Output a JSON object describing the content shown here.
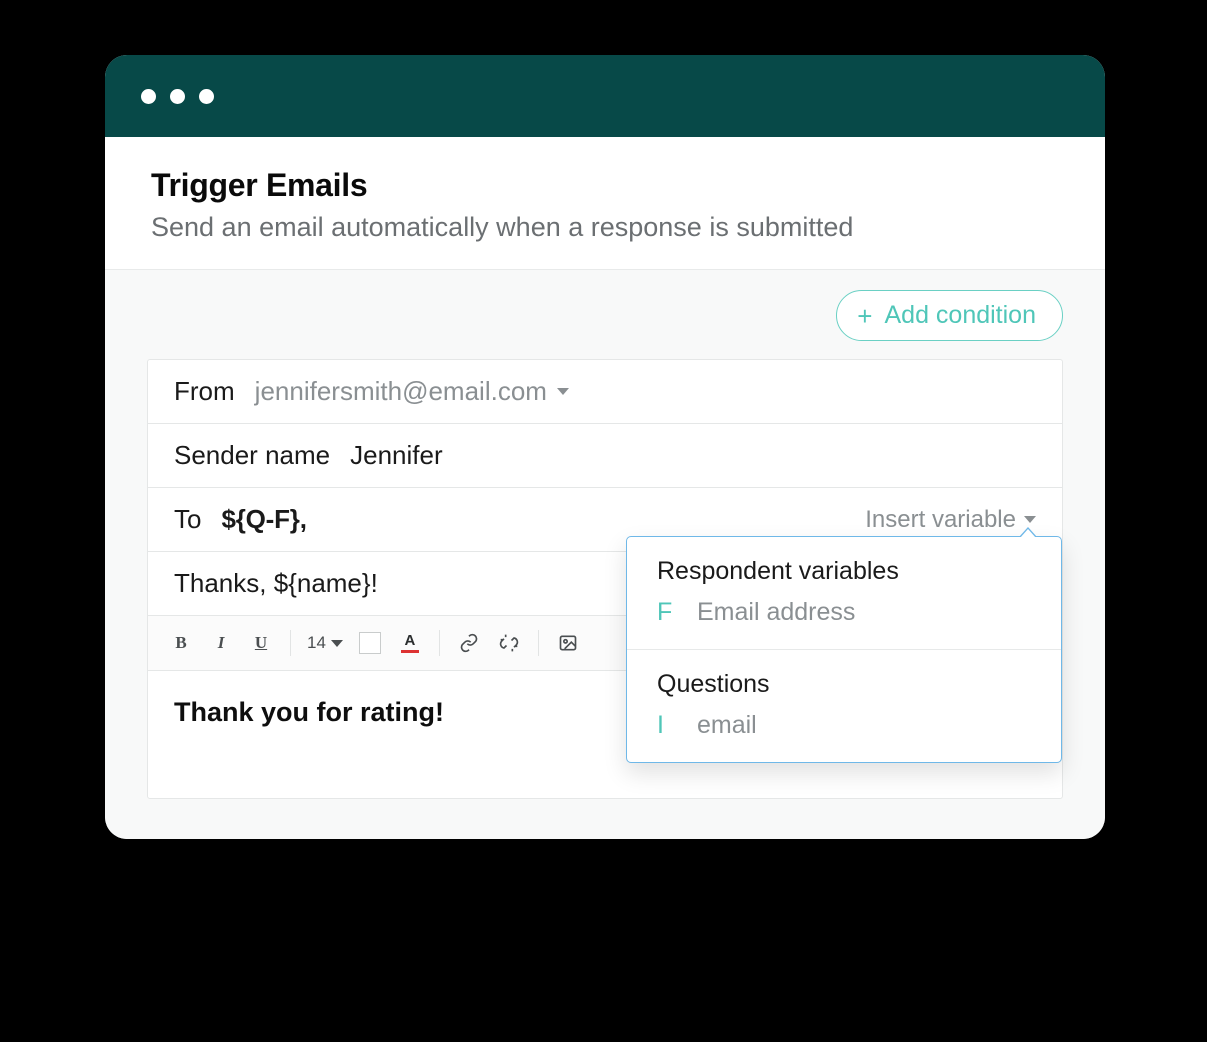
{
  "header": {
    "title": "Trigger Emails",
    "subtitle": "Send an email automatically when a response is submitted"
  },
  "actions": {
    "add_condition": "Add condition"
  },
  "form": {
    "from_label": "From",
    "from_value": "jennifersmith@email.com",
    "sender_name_label": "Sender name",
    "sender_name_value": "Jennifer",
    "to_label": "To",
    "to_value": "${Q-F},",
    "insert_variable_label": "Insert variable",
    "subject_value": "Thanks, ${name}!",
    "body_value": "Thank you for rating!"
  },
  "toolbar": {
    "font_size": "14"
  },
  "popover": {
    "section1_title": "Respondent variables",
    "section1_item_key": "F",
    "section1_item_label": "Email address",
    "section2_title": "Questions",
    "section2_item_key": "I",
    "section2_item_label": "email"
  }
}
